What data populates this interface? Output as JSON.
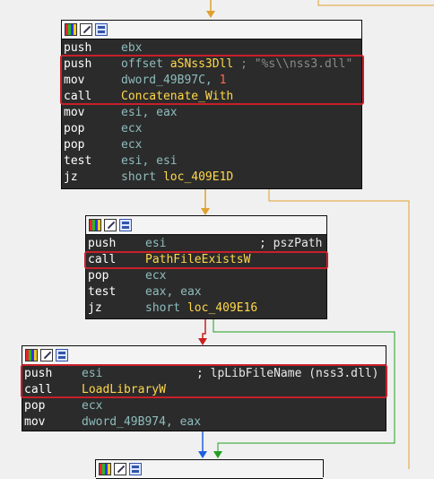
{
  "block1": {
    "rows": [
      {
        "mnemonic": "push",
        "op1": "ebx"
      },
      {
        "mnemonic": "push",
        "op_keyword": "offset ",
        "op_name": "aSNss3Dll",
        "comment": " ; \"%s\\\\nss3.dll\""
      },
      {
        "mnemonic": "mov",
        "op1": "dword_49B97C, ",
        "op_num": "1"
      },
      {
        "mnemonic": "call",
        "op_name": "Concatenate_With"
      },
      {
        "mnemonic": "mov",
        "op1": "esi, eax"
      },
      {
        "mnemonic": "pop",
        "op1": "ecx"
      },
      {
        "mnemonic": "pop",
        "op1": "ecx"
      },
      {
        "mnemonic": "test",
        "op1": "esi, esi"
      },
      {
        "mnemonic": "jz",
        "op_keyword": "short ",
        "op_name": "loc_409E1D"
      }
    ]
  },
  "block2": {
    "rows": [
      {
        "mnemonic": "push",
        "op1": "esi",
        "comment_plain": "; pszPath"
      },
      {
        "mnemonic": "call",
        "op_name": "PathFileExistsW"
      },
      {
        "mnemonic": "pop",
        "op1": "ecx"
      },
      {
        "mnemonic": "test",
        "op1": "eax, eax"
      },
      {
        "mnemonic": "jz",
        "op_keyword": "short ",
        "op_name": "loc_409E16"
      }
    ]
  },
  "block3": {
    "rows": [
      {
        "mnemonic": "push",
        "op1": "esi",
        "comment_plain": "; lpLibFileName (nss3.dll)"
      },
      {
        "mnemonic": "call",
        "op_name": "LoadLibraryW"
      },
      {
        "mnemonic": "pop",
        "op1": "ecx"
      },
      {
        "mnemonic": "mov",
        "op1": "dword_49B974, eax"
      }
    ]
  },
  "colors": {
    "block_bg": "#2b2b2b",
    "mnemonic": "#ffffff",
    "operand": "#8fbcbc",
    "name": "#ffd84a",
    "number": "#ff6a4a",
    "highlight": "#c8202a",
    "edge_orange": "#e0a030",
    "edge_red": "#c82020",
    "edge_green": "#20a020",
    "edge_blue": "#2060e0"
  }
}
